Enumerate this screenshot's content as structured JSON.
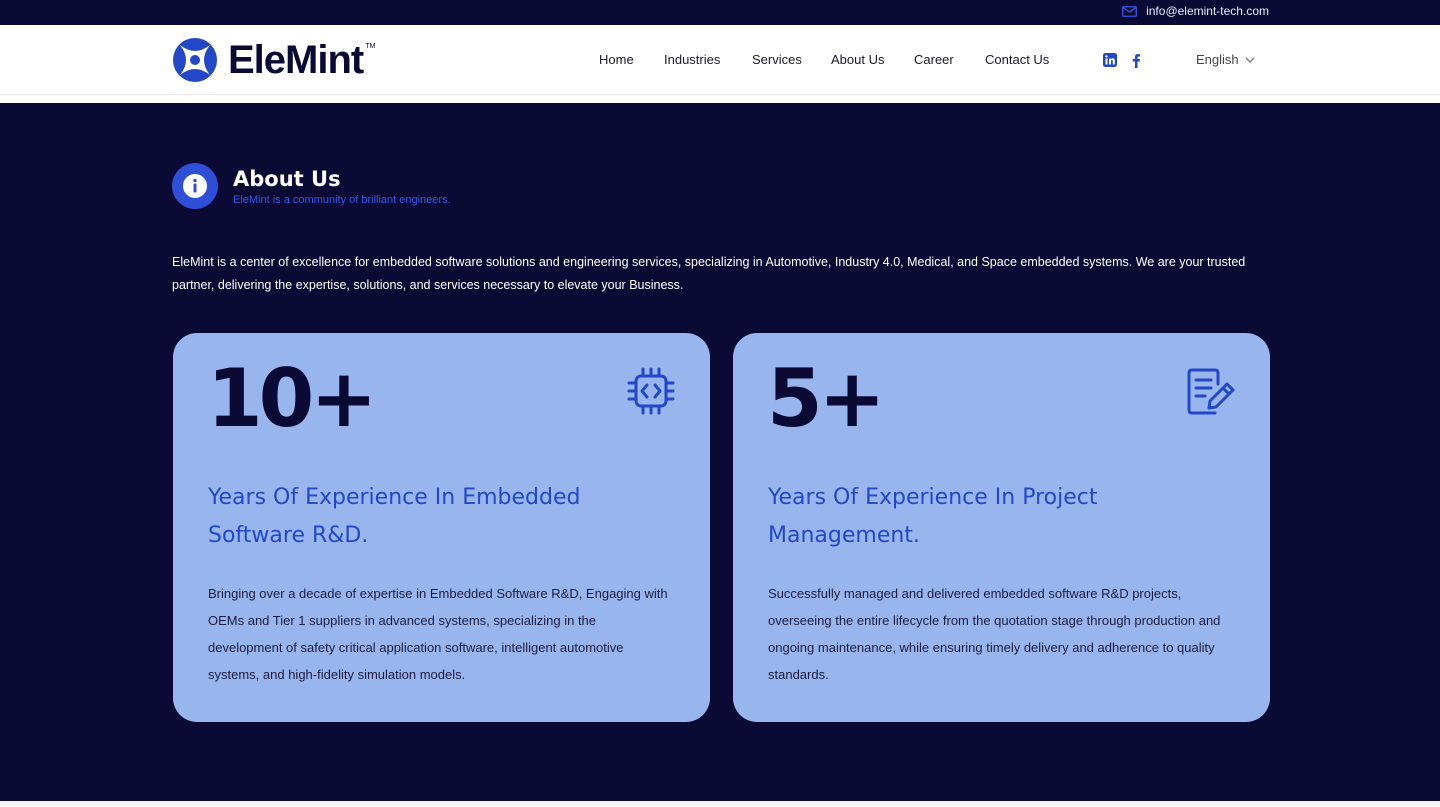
{
  "topbar": {
    "email": "info@elemint-tech.com",
    "email_icon": "mail-icon"
  },
  "header": {
    "logo_text": "EleMint",
    "logo_tm": "TM",
    "nav": [
      {
        "label": "Home"
      },
      {
        "label": "Industries"
      },
      {
        "label": "Services"
      },
      {
        "label": "About Us"
      },
      {
        "label": "Career"
      },
      {
        "label": "Contact Us"
      }
    ],
    "social": [
      "linkedin-icon",
      "facebook-icon"
    ],
    "language": "English"
  },
  "about": {
    "title": "About Us",
    "subtitle": "EleMint is a community of brilliant engineers.",
    "icon": "info-icon",
    "intro": "EleMint is a center of excellence for embedded software solutions and engineering services, specializing in Automotive, Industry 4.0, Medical, and Space embedded systems. We are your trusted partner, delivering the expertise, solutions, and services necessary to elevate your Business."
  },
  "cards": [
    {
      "number": "10+",
      "icon": "chip-code-icon",
      "heading": "Years Of Experience In Embedded Software R&D.",
      "body": "Bringing over a decade of expertise in Embedded Software R&D, Engaging with OEMs and Tier 1 suppliers in advanced systems, specializing in the development of safety critical application software, intelligent automotive systems, and high-fidelity simulation models."
    },
    {
      "number": "5+",
      "icon": "document-edit-icon",
      "heading": "Years Of Experience In Project Management.",
      "body": "Successfully managed and delivered embedded software R&D projects, overseeing the entire lifecycle from the quotation stage through production and ongoing maintenance, while ensuring timely delivery and adherence to quality standards."
    }
  ],
  "colors": {
    "background": "#0b0a35",
    "accent": "#2f4fd9",
    "card": "#98b5ed",
    "card_heading": "#2447c8"
  }
}
